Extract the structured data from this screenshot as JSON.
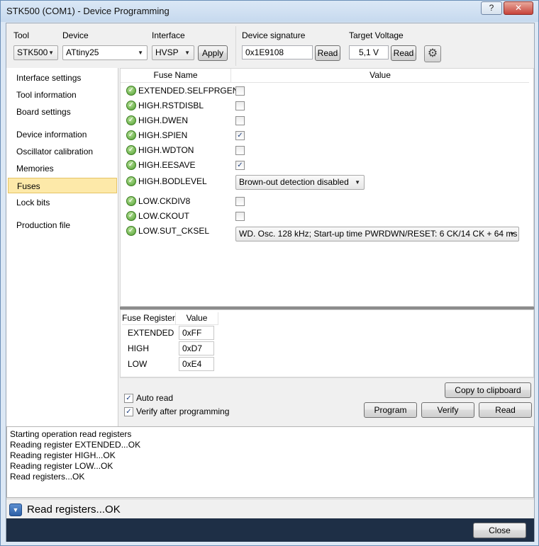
{
  "window": {
    "title": "STK500 (COM1) - Device Programming",
    "help_label": "?",
    "close_label": "✕"
  },
  "toolbar": {
    "tool_label": "Tool",
    "tool_value": "STK500",
    "device_label": "Device",
    "device_value": "ATtiny25",
    "interface_label": "Interface",
    "interface_value": "HVSP",
    "apply_label": "Apply",
    "signature_label": "Device signature",
    "signature_value": "0x1E9108",
    "signature_read_label": "Read",
    "voltage_label": "Target Voltage",
    "voltage_value": "5,1 V",
    "voltage_read_label": "Read",
    "settings_icon": "gear-icon"
  },
  "sidebar": {
    "items": [
      {
        "label": "Interface settings"
      },
      {
        "label": "Tool information"
      },
      {
        "label": "Board settings"
      },
      {
        "label": "Device information"
      },
      {
        "label": "Oscillator calibration"
      },
      {
        "label": "Memories"
      },
      {
        "label": "Fuses"
      },
      {
        "label": "Lock bits"
      },
      {
        "label": "Production file"
      }
    ],
    "active": "Fuses"
  },
  "fuses": {
    "col_name": "Fuse Name",
    "col_value": "Value",
    "rows": [
      {
        "name": "EXTENDED.SELFPRGEN",
        "checked": false
      },
      {
        "name": "HIGH.RSTDISBL",
        "checked": false
      },
      {
        "name": "HIGH.DWEN",
        "checked": false
      },
      {
        "name": "HIGH.SPIEN",
        "checked": true
      },
      {
        "name": "HIGH.WDTON",
        "checked": false
      },
      {
        "name": "HIGH.EESAVE",
        "checked": true
      },
      {
        "name": "HIGH.BODLEVEL",
        "dropdown": "Brown-out detection disabled"
      },
      {
        "name": "LOW.CKDIV8",
        "checked": false
      },
      {
        "name": "LOW.CKOUT",
        "checked": false
      },
      {
        "name": "LOW.SUT_CKSEL",
        "dropdown": "WD. Osc. 128 kHz; Start-up time PWRDWN/RESET: 6 CK/14 CK + 64 ms"
      }
    ],
    "check_mark": "✓"
  },
  "registers": {
    "col_register": "Fuse Register",
    "col_value": "Value",
    "rows": [
      {
        "name": "EXTENDED",
        "value": "0xFF"
      },
      {
        "name": "HIGH",
        "value": "0xD7"
      },
      {
        "name": "LOW",
        "value": "0xE4"
      }
    ]
  },
  "options": {
    "auto_read_label": "Auto read",
    "auto_read_checked": true,
    "verify_label": "Verify after programming",
    "verify_checked": true,
    "copy_label": "Copy to clipboard",
    "program_label": "Program",
    "verify_button_label": "Verify",
    "read_label": "Read"
  },
  "log": {
    "lines": [
      "Starting operation read registers",
      "Reading register EXTENDED...OK",
      "Reading register HIGH...OK",
      "Reading register LOW...OK",
      "Read registers...OK"
    ]
  },
  "status": {
    "text": "Read registers...OK",
    "expander_glyph": "▼"
  },
  "footer": {
    "close_label": "Close"
  }
}
